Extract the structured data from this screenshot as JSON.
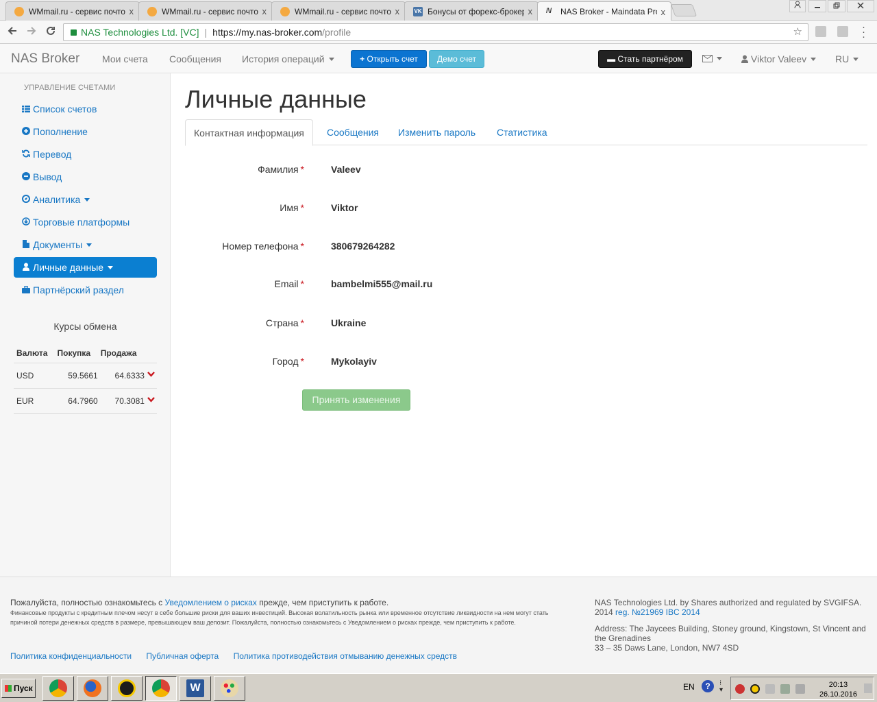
{
  "browser": {
    "tabs": [
      {
        "title": "WMmail.ru - сервис почтов",
        "favicon": "wmmail-icon"
      },
      {
        "title": "WMmail.ru - сервис почтов",
        "favicon": "wmmail-icon"
      },
      {
        "title": "WMmail.ru - сервис почтов",
        "favicon": "wmmail-icon"
      },
      {
        "title": "Бонусы от форекс-брокер",
        "favicon": "vk-icon",
        "favicon_text": "VK"
      },
      {
        "title": "NAS Broker - Maindata Profi",
        "favicon": "nas-icon",
        "favicon_text": "/\\/",
        "active": true
      }
    ],
    "close_glyph": "x",
    "address": {
      "org": "NAS Technologies Ltd. [VC]",
      "scheme_host": "https://my.nas-broker.com",
      "path": "/profile"
    }
  },
  "site": {
    "brand": "NAS Broker",
    "nav": {
      "accounts": "Мои счета",
      "messages": "Сообщения",
      "history": "История операций",
      "open_account": "Открыть счет",
      "demo_account": "Демо счет",
      "partner": "Стать партнёром",
      "user": "Viktor Valeev",
      "lang": "RU"
    },
    "sidebar": {
      "heading": "УПРАВЛЕНИЕ СЧЕТАМИ",
      "items": [
        {
          "label": "Список счетов",
          "icon": "list-icon"
        },
        {
          "label": "Пополнение",
          "icon": "plus-circle-icon"
        },
        {
          "label": "Перевод",
          "icon": "refresh-icon"
        },
        {
          "label": "Вывод",
          "icon": "minus-circle-icon"
        },
        {
          "label": "Аналитика",
          "icon": "compass-icon",
          "dropdown": true
        },
        {
          "label": "Торговые платформы",
          "icon": "download-icon"
        },
        {
          "label": "Документы",
          "icon": "file-icon",
          "dropdown": true
        },
        {
          "label": "Личные данные",
          "icon": "user-icon",
          "dropdown": true,
          "active": true
        },
        {
          "label": "Партнёрский раздел",
          "icon": "briefcase-icon"
        }
      ]
    },
    "rates": {
      "title": "Курсы обмена",
      "headers": [
        "Валюта",
        "Покупка",
        "Продажа"
      ],
      "rows": [
        {
          "currency": "USD",
          "buy": "59.5661",
          "sell": "64.6333",
          "trend": "down"
        },
        {
          "currency": "EUR",
          "buy": "64.7960",
          "sell": "70.3081",
          "trend": "down"
        }
      ]
    },
    "page": {
      "title": "Личные данные",
      "tabs": [
        "Контактная информация",
        "Сообщения",
        "Изменить пароль",
        "Статистика"
      ],
      "fields": [
        {
          "label": "Фамилия",
          "value": "Valeev"
        },
        {
          "label": "Имя",
          "value": "Viktor"
        },
        {
          "label": "Номер телефона",
          "value": "380679264282"
        },
        {
          "label": "Email",
          "value": "bambelmi555@mail.ru"
        },
        {
          "label": "Страна",
          "value": "Ukraine"
        },
        {
          "label": "Город",
          "value": "Mykolayiv"
        }
      ],
      "required_mark": "*",
      "submit": "Принять изменения"
    },
    "footer": {
      "lead_before": "Пожалуйста, полностью ознакомьтесь с",
      "lead_link": "Уведомлением о рисках",
      "lead_after": "прежде, чем приступить к работе.",
      "small": "Финансовые продукты с кредитным плечом несут в себе большие риски для ваших инвестиций. Высокая волатильность рынка или временное отсутствие ликвидности на нем могут стать причиной потери денежных средств в размере, превышающем ваш депозит. Пожалуйста, полностью ознакомьтесь с Уведомлением о рисках прежде, чем приступить к работе.",
      "links": [
        "Политика конфиденциальности",
        "Публичная оферта",
        "Политика противодействия отмыванию денежных средств"
      ],
      "company_line": "NAS Technologies Ltd. by Shares authorized and regulated by SVGIFSA.",
      "reg_year": "2014",
      "reg_link": "reg. №21969 IBC 2014",
      "address": "Address: The Jaycees Building, Stoney ground, Kingstown, St Vincent and the Grenadines",
      "address2": "33 – 35 Daws Lane, London, NW7 4SD"
    }
  },
  "taskbar": {
    "start": "Пуск",
    "lang": "EN",
    "help": "?",
    "time": "20:13",
    "date": "26.10.2016"
  }
}
